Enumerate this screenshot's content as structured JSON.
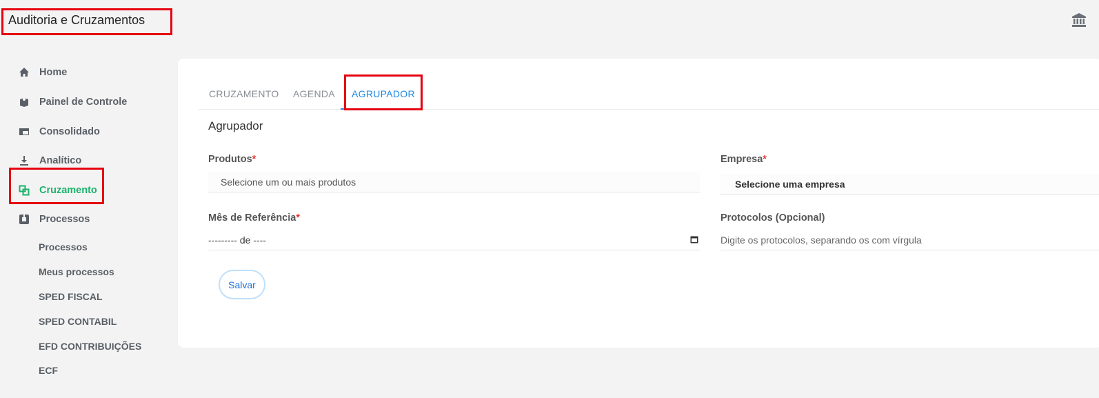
{
  "header": {
    "title": "Auditoria e Cruzamentos",
    "icon": "bank-icon"
  },
  "sidebar": {
    "items": [
      {
        "label": "Home",
        "icon": "home-icon"
      },
      {
        "label": "Painel de Controle",
        "icon": "book-icon"
      },
      {
        "label": "Consolidado",
        "icon": "layout-icon"
      },
      {
        "label": "Analítico",
        "icon": "download-icon"
      },
      {
        "label": "Cruzamento",
        "icon": "crossing-icon",
        "active": true
      },
      {
        "label": "Processos",
        "icon": "process-icon"
      }
    ],
    "sub_items": [
      "Processos",
      "Meus processos",
      "SPED FISCAL",
      "SPED CONTABIL",
      "EFD CONTRIBUIÇÕES",
      "ECF"
    ]
  },
  "tabs": [
    {
      "label": "CRUZAMENTO"
    },
    {
      "label": "AGENDA"
    },
    {
      "label": "AGRUPADOR",
      "active": true
    }
  ],
  "form": {
    "title": "Agrupador",
    "produtos": {
      "label": "Produtos",
      "required": "*",
      "placeholder": "Selecione um ou mais produtos"
    },
    "empresa": {
      "label": "Empresa",
      "required": "*",
      "value": "Selecione uma empresa"
    },
    "mes": {
      "label": "Mês de Referência",
      "required": "*",
      "value": "--------- de ----"
    },
    "protocolos": {
      "label": "Protocolos (Opcional)",
      "placeholder": "Digite os protocolos, separando os com vírgula"
    },
    "save_label": "Salvar"
  },
  "colors": {
    "active_green": "#1bb36a",
    "accent_blue": "#1e88e5",
    "highlight_red": "#e6000f"
  }
}
